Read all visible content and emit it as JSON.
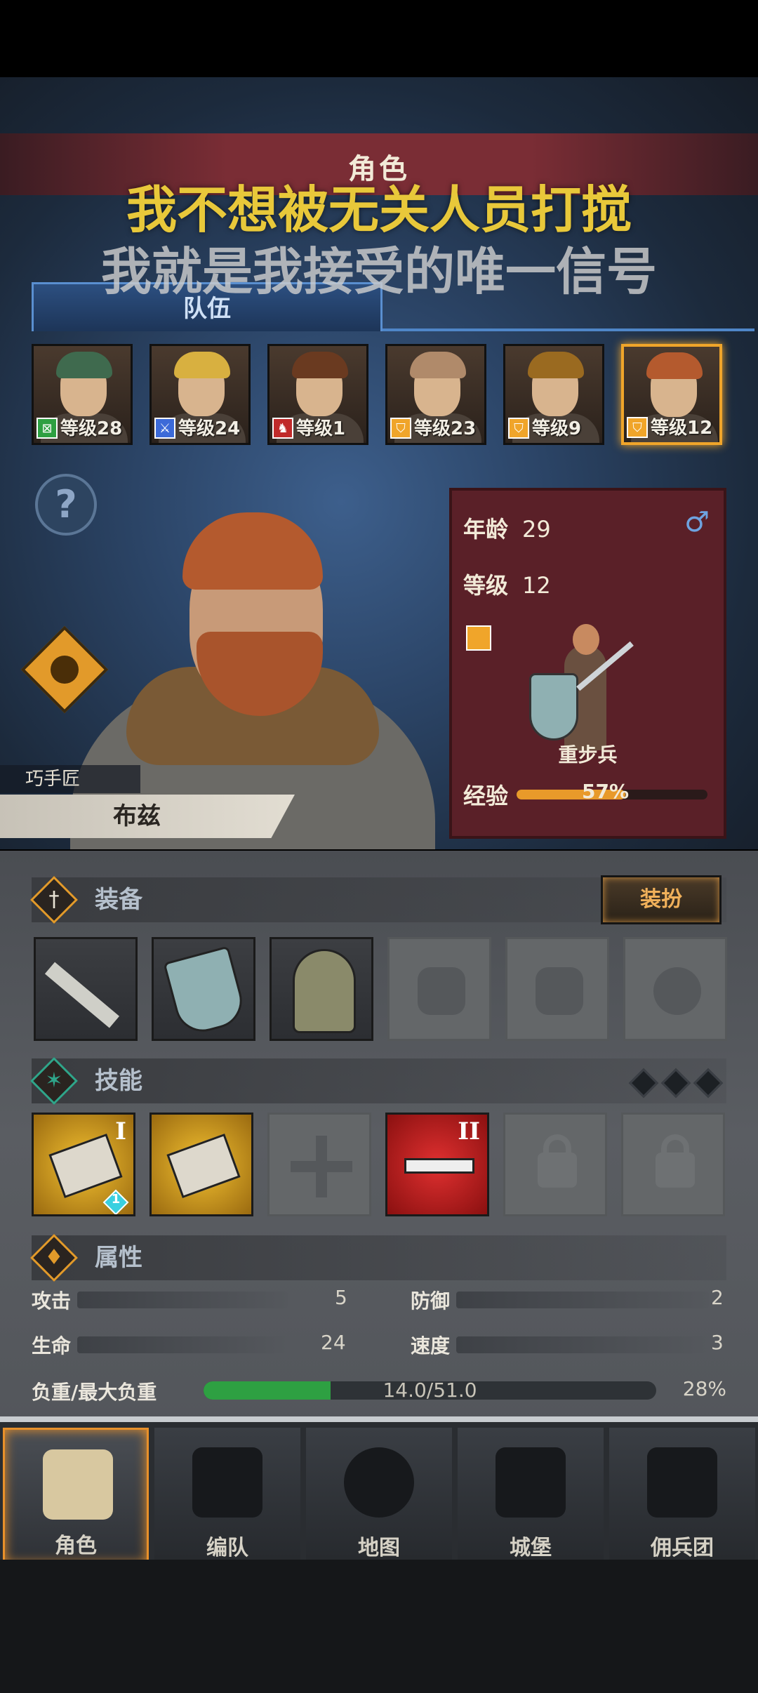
{
  "overlay": {
    "line1": "我不想被无关人员打搅",
    "line2": "我就是我接受的唯一信号"
  },
  "header": {
    "title": "角色"
  },
  "tabs": {
    "team": "队伍"
  },
  "roster": [
    {
      "level": "等级28",
      "hair": "#3f6a4e",
      "badge_color": "#2ea042",
      "badge_icon": "⊠"
    },
    {
      "level": "等级24",
      "hair": "#d8b040",
      "badge_color": "#3c6ad8",
      "badge_icon": "⚔"
    },
    {
      "level": "等级1",
      "hair": "#6a3a20",
      "badge_color": "#c02a2a",
      "badge_icon": "♞"
    },
    {
      "level": "等级23",
      "hair": "#b08a6a",
      "badge_color": "#f0a52a",
      "badge_icon": "⛉"
    },
    {
      "level": "等级9",
      "hair": "#9a6a20",
      "badge_color": "#f0a52a",
      "badge_icon": "⛉"
    },
    {
      "level": "等级12",
      "hair": "#b45a2e",
      "badge_color": "#f0a52a",
      "badge_icon": "⛉"
    }
  ],
  "character": {
    "trait": "巧手匠",
    "name": "布兹",
    "age_label": "年龄",
    "age": "29",
    "level_label": "等级",
    "level": "12",
    "gender_symbol": "♂",
    "unit_type": "重步兵",
    "exp_label": "经验",
    "exp_percent": "57%",
    "exp_fraction": 0.57
  },
  "equipment": {
    "title": "装备",
    "dress_button": "装扮",
    "slots": [
      {
        "icon": "machete-icon",
        "state": "filled"
      },
      {
        "icon": "shield-icon",
        "state": "filled"
      },
      {
        "icon": "helmet-icon",
        "state": "filled"
      },
      {
        "icon": "chest-armor-icon",
        "state": "empty"
      },
      {
        "icon": "boots-icon",
        "state": "empty"
      },
      {
        "icon": "ring-icon",
        "state": "empty"
      }
    ]
  },
  "skills": {
    "title": "技能",
    "slots": [
      {
        "icon": "shield-bash-icon",
        "state": "gold",
        "rank": "I",
        "badge": "1"
      },
      {
        "icon": "gauntlet-icon",
        "state": "gold",
        "rank": "",
        "badge": ""
      },
      {
        "icon": "empty-skill-icon",
        "state": "empty",
        "rank": "",
        "badge": ""
      },
      {
        "icon": "dumbbell-icon",
        "state": "red",
        "rank": "II",
        "badge": ""
      },
      {
        "icon": "lock-icon",
        "state": "locked",
        "rank": "",
        "badge": ""
      },
      {
        "icon": "lock-icon",
        "state": "locked",
        "rank": "",
        "badge": ""
      }
    ]
  },
  "attributes": {
    "title": "属性",
    "attack_label": "攻击",
    "attack": "5",
    "defense_label": "防御",
    "defense": "2",
    "hp_label": "生命",
    "hp": "24",
    "speed_label": "速度",
    "speed": "3",
    "load_label": "负重/最大负重",
    "load_value": "14.0/51.0",
    "load_percent": "28%",
    "load_fraction": 0.28
  },
  "nav": {
    "character": "角色",
    "formation": "编队",
    "map": "地图",
    "castle": "城堡",
    "mercenary": "佣兵团"
  },
  "colors": {
    "accent_orange": "#f0a52a",
    "panel_red": "#5a2028",
    "overlay_yellow": "#e8c83a"
  }
}
